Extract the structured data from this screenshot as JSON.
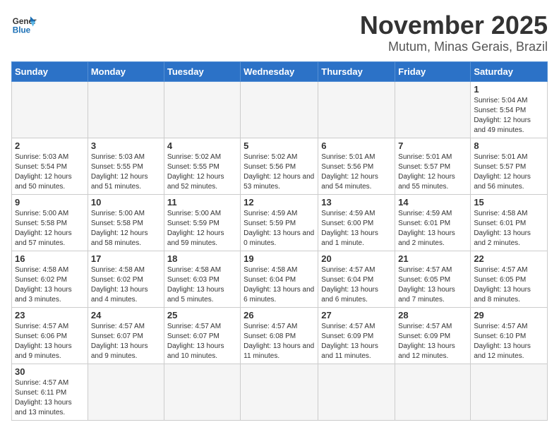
{
  "logo": {
    "text_general": "General",
    "text_blue": "Blue"
  },
  "title": "November 2025",
  "location": "Mutum, Minas Gerais, Brazil",
  "weekdays": [
    "Sunday",
    "Monday",
    "Tuesday",
    "Wednesday",
    "Thursday",
    "Friday",
    "Saturday"
  ],
  "weeks": [
    [
      {
        "day": "",
        "info": ""
      },
      {
        "day": "",
        "info": ""
      },
      {
        "day": "",
        "info": ""
      },
      {
        "day": "",
        "info": ""
      },
      {
        "day": "",
        "info": ""
      },
      {
        "day": "",
        "info": ""
      },
      {
        "day": "1",
        "info": "Sunrise: 5:04 AM\nSunset: 5:54 PM\nDaylight: 12 hours\nand 49 minutes."
      }
    ],
    [
      {
        "day": "2",
        "info": "Sunrise: 5:03 AM\nSunset: 5:54 PM\nDaylight: 12 hours\nand 50 minutes."
      },
      {
        "day": "3",
        "info": "Sunrise: 5:03 AM\nSunset: 5:55 PM\nDaylight: 12 hours\nand 51 minutes."
      },
      {
        "day": "4",
        "info": "Sunrise: 5:02 AM\nSunset: 5:55 PM\nDaylight: 12 hours\nand 52 minutes."
      },
      {
        "day": "5",
        "info": "Sunrise: 5:02 AM\nSunset: 5:56 PM\nDaylight: 12 hours\nand 53 minutes."
      },
      {
        "day": "6",
        "info": "Sunrise: 5:01 AM\nSunset: 5:56 PM\nDaylight: 12 hours\nand 54 minutes."
      },
      {
        "day": "7",
        "info": "Sunrise: 5:01 AM\nSunset: 5:57 PM\nDaylight: 12 hours\nand 55 minutes."
      },
      {
        "day": "8",
        "info": "Sunrise: 5:01 AM\nSunset: 5:57 PM\nDaylight: 12 hours\nand 56 minutes."
      }
    ],
    [
      {
        "day": "9",
        "info": "Sunrise: 5:00 AM\nSunset: 5:58 PM\nDaylight: 12 hours\nand 57 minutes."
      },
      {
        "day": "10",
        "info": "Sunrise: 5:00 AM\nSunset: 5:58 PM\nDaylight: 12 hours\nand 58 minutes."
      },
      {
        "day": "11",
        "info": "Sunrise: 5:00 AM\nSunset: 5:59 PM\nDaylight: 12 hours\nand 59 minutes."
      },
      {
        "day": "12",
        "info": "Sunrise: 4:59 AM\nSunset: 5:59 PM\nDaylight: 13 hours\nand 0 minutes."
      },
      {
        "day": "13",
        "info": "Sunrise: 4:59 AM\nSunset: 6:00 PM\nDaylight: 13 hours\nand 1 minute."
      },
      {
        "day": "14",
        "info": "Sunrise: 4:59 AM\nSunset: 6:01 PM\nDaylight: 13 hours\nand 2 minutes."
      },
      {
        "day": "15",
        "info": "Sunrise: 4:58 AM\nSunset: 6:01 PM\nDaylight: 13 hours\nand 2 minutes."
      }
    ],
    [
      {
        "day": "16",
        "info": "Sunrise: 4:58 AM\nSunset: 6:02 PM\nDaylight: 13 hours\nand 3 minutes."
      },
      {
        "day": "17",
        "info": "Sunrise: 4:58 AM\nSunset: 6:02 PM\nDaylight: 13 hours\nand 4 minutes."
      },
      {
        "day": "18",
        "info": "Sunrise: 4:58 AM\nSunset: 6:03 PM\nDaylight: 13 hours\nand 5 minutes."
      },
      {
        "day": "19",
        "info": "Sunrise: 4:58 AM\nSunset: 6:04 PM\nDaylight: 13 hours\nand 6 minutes."
      },
      {
        "day": "20",
        "info": "Sunrise: 4:57 AM\nSunset: 6:04 PM\nDaylight: 13 hours\nand 6 minutes."
      },
      {
        "day": "21",
        "info": "Sunrise: 4:57 AM\nSunset: 6:05 PM\nDaylight: 13 hours\nand 7 minutes."
      },
      {
        "day": "22",
        "info": "Sunrise: 4:57 AM\nSunset: 6:05 PM\nDaylight: 13 hours\nand 8 minutes."
      }
    ],
    [
      {
        "day": "23",
        "info": "Sunrise: 4:57 AM\nSunset: 6:06 PM\nDaylight: 13 hours\nand 9 minutes."
      },
      {
        "day": "24",
        "info": "Sunrise: 4:57 AM\nSunset: 6:07 PM\nDaylight: 13 hours\nand 9 minutes."
      },
      {
        "day": "25",
        "info": "Sunrise: 4:57 AM\nSunset: 6:07 PM\nDaylight: 13 hours\nand 10 minutes."
      },
      {
        "day": "26",
        "info": "Sunrise: 4:57 AM\nSunset: 6:08 PM\nDaylight: 13 hours\nand 11 minutes."
      },
      {
        "day": "27",
        "info": "Sunrise: 4:57 AM\nSunset: 6:09 PM\nDaylight: 13 hours\nand 11 minutes."
      },
      {
        "day": "28",
        "info": "Sunrise: 4:57 AM\nSunset: 6:09 PM\nDaylight: 13 hours\nand 12 minutes."
      },
      {
        "day": "29",
        "info": "Sunrise: 4:57 AM\nSunset: 6:10 PM\nDaylight: 13 hours\nand 12 minutes."
      }
    ],
    [
      {
        "day": "30",
        "info": "Sunrise: 4:57 AM\nSunset: 6:11 PM\nDaylight: 13 hours\nand 13 minutes."
      },
      {
        "day": "",
        "info": ""
      },
      {
        "day": "",
        "info": ""
      },
      {
        "day": "",
        "info": ""
      },
      {
        "day": "",
        "info": ""
      },
      {
        "day": "",
        "info": ""
      },
      {
        "day": "",
        "info": ""
      }
    ]
  ]
}
